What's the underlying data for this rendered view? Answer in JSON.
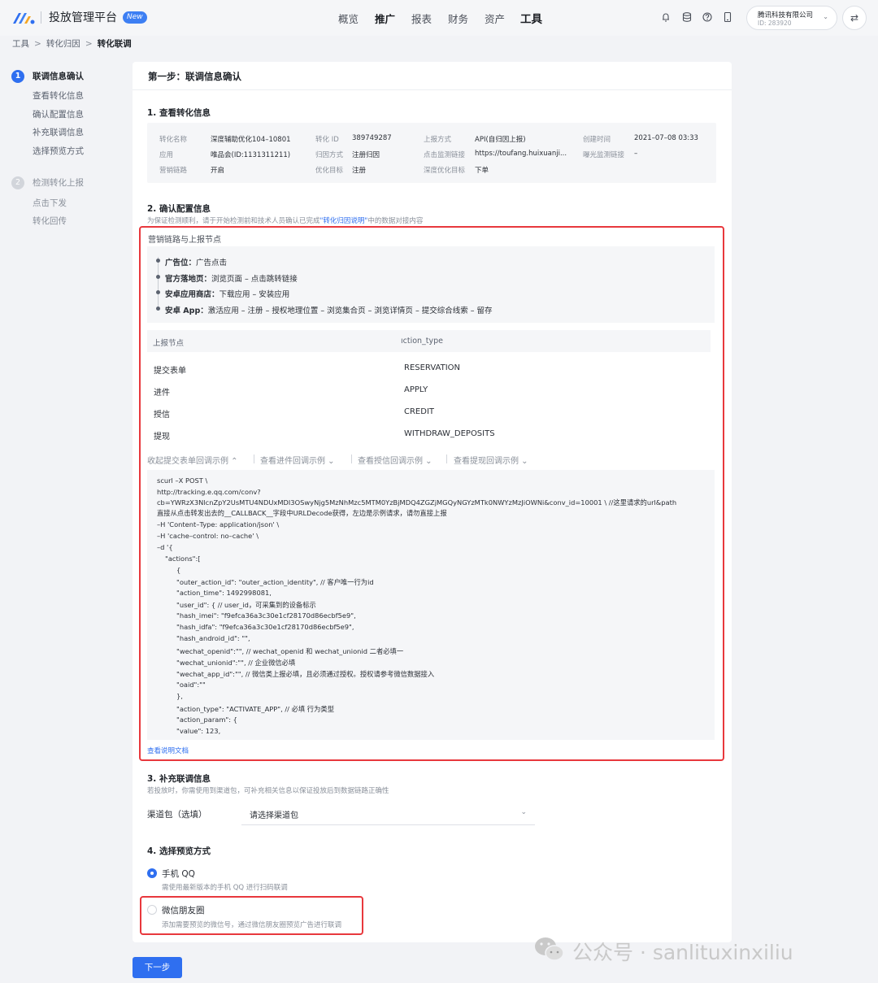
{
  "header": {
    "brand_title": "投放管理平台",
    "new_badge": "New",
    "nav": [
      "概览",
      "推广",
      "报表",
      "财务",
      "资产",
      "工具"
    ],
    "account_name": "腾讯科技有限公司",
    "account_id": "ID: 283920",
    "icons": [
      "bell-icon",
      "database-icon",
      "help-icon",
      "mobile-icon",
      "swap-icon"
    ]
  },
  "breadcrumb": [
    "工具",
    "转化归因",
    "转化联调"
  ],
  "sidebar": {
    "steps": [
      {
        "num": "1",
        "label": "联调信息确认",
        "subs": [
          "查看转化信息",
          "确认配置信息",
          "补充联调信息",
          "选择预览方式"
        ]
      },
      {
        "num": "2",
        "label": "检测转化上报",
        "subs": [
          "点击下发",
          "转化回传"
        ]
      }
    ]
  },
  "main": {
    "title": "第一步：联调信息确认",
    "sec1_title": "1. 查看转化信息",
    "info": [
      {
        "k": "转化名称",
        "v": "深度辅助优化104–10801"
      },
      {
        "k": "转化 ID",
        "v": "389749287"
      },
      {
        "k": "上报方式",
        "v": "API(自归因上报)"
      },
      {
        "k": "创建时间",
        "v": "2021–07–08 03:33"
      },
      {
        "k": "应用",
        "v": "唯品会(ID:1131311211)"
      },
      {
        "k": "归因方式",
        "v": "注册归因"
      },
      {
        "k": "点击监测链接",
        "v": "https://toufang.huixuanji..."
      },
      {
        "k": "曝光监测链接",
        "v": "–"
      },
      {
        "k": "营销链路",
        "v": "开启"
      },
      {
        "k": "优化目标",
        "v": "注册"
      },
      {
        "k": "深度优化目标",
        "v": "下单"
      }
    ],
    "sec2_title": "2. 确认配置信息",
    "sec2_note_pre": "为保证检测顺利，请于开始检测前和技术人员确认已完成",
    "sec2_note_link": "\"转化归因说明\"",
    "sec2_note_post": "中的数据对接内容",
    "path_title": "营销链路与上报节点",
    "paths": [
      {
        "name": "广告位：",
        "steps": "广告点击"
      },
      {
        "name": "官方落地页：",
        "steps": "浏览页面 – 点击跳转链接"
      },
      {
        "name": "安卓应用商店：",
        "steps": "下载应用 – 安装应用"
      },
      {
        "name": "安卓 App：",
        "steps": "激活应用 – 注册 – 授权地理位置 – 浏览集合页 – 浏览详情页 – 提交综合线索 – 留存"
      }
    ],
    "table_headers": [
      "上报节点",
      "ıction_type"
    ],
    "table_rows": [
      [
        "提交表单",
        "RESERVATION"
      ],
      [
        "进件",
        "APPLY"
      ],
      [
        "授信",
        "CREDIT"
      ],
      [
        "提现",
        "WITHDRAW_DEPOSITS"
      ]
    ],
    "examples": [
      "收起提交表单回调示例 ⌃",
      "查看进件回调示例 ⌄",
      "查看授信回调示例 ⌄",
      "查看提现回调示例 ⌄"
    ],
    "code": [
      "scurl –X POST \\",
      "http://tracking.e.qq.com/conv?",
      "cb=YWRzX3NlcnZpY2UsMTU4NDUxMDI3OSwyNjg5MzNhMzc5MTM0YzBjMDQ4ZGZjMGQyNGYzMTk0NWYzMzJiOWNi&conv_id=10001 \\ //这里请求的url&path",
      "直接从点击转发出去的__CALLBACK__字段中URLDecode获得，左边是示例请求，请勿直接上报",
      "–H 'Content–Type: application/json' \\",
      "–H 'cache–control: no–cache' \\",
      "–d '{",
      "\"actions\":[",
      "{",
      "\"outer_action_id\": \"outer_action_identity\", // 客户唯一行为id",
      "\"action_time\": 1492998081,",
      "\"user_id\": { // user_id，可采集到的设备标示",
      "\"hash_imei\": \"f9efca36a3c30e1cf28170d86ecbf5e9\",",
      "\"hash_idfa\": \"f9efca36a3c30e1cf28170d86ecbf5e9\",",
      "\"hash_android_id\": \"\",",
      "\"wechat_openid\":\"\", // wechat_openid 和 wechat_unionid 二者必填一",
      "\"wechat_unionid\":\"\", // 企业微信必填",
      "\"wechat_app_id\":\"\", // 微信类上报必填，且必须通过授权。授权请参考微信数据接入",
      "\"oaid\":\"\"",
      "},",
      "\"action_type\": \"ACTIVATE_APP\", // 必填 行为类型",
      "\"action_param\": {",
      "\"value\": 123,"
    ],
    "doc_link": "查看说明文档",
    "sec3_title": "3. 补充联调信息",
    "sec3_note": "若投放时，你需使用到渠道包，可补充相关信息以保证投放后到数据链路正确性",
    "channel_label": "渠道包（选填）",
    "channel_placeholder": "请选择渠道包",
    "sec4_title": "4. 选择预览方式",
    "opt1_label": "手机 QQ",
    "opt1_desc": "需使用最新版本的手机 QQ 进行扫码联调",
    "opt2_label": "微信朋友圈",
    "opt2_desc": "添加需要预览的微信号，通过微信朋友圈预览广告进行联调",
    "next_button": "下一步"
  },
  "watermark": "公众号 · sanlituxinxiliu"
}
